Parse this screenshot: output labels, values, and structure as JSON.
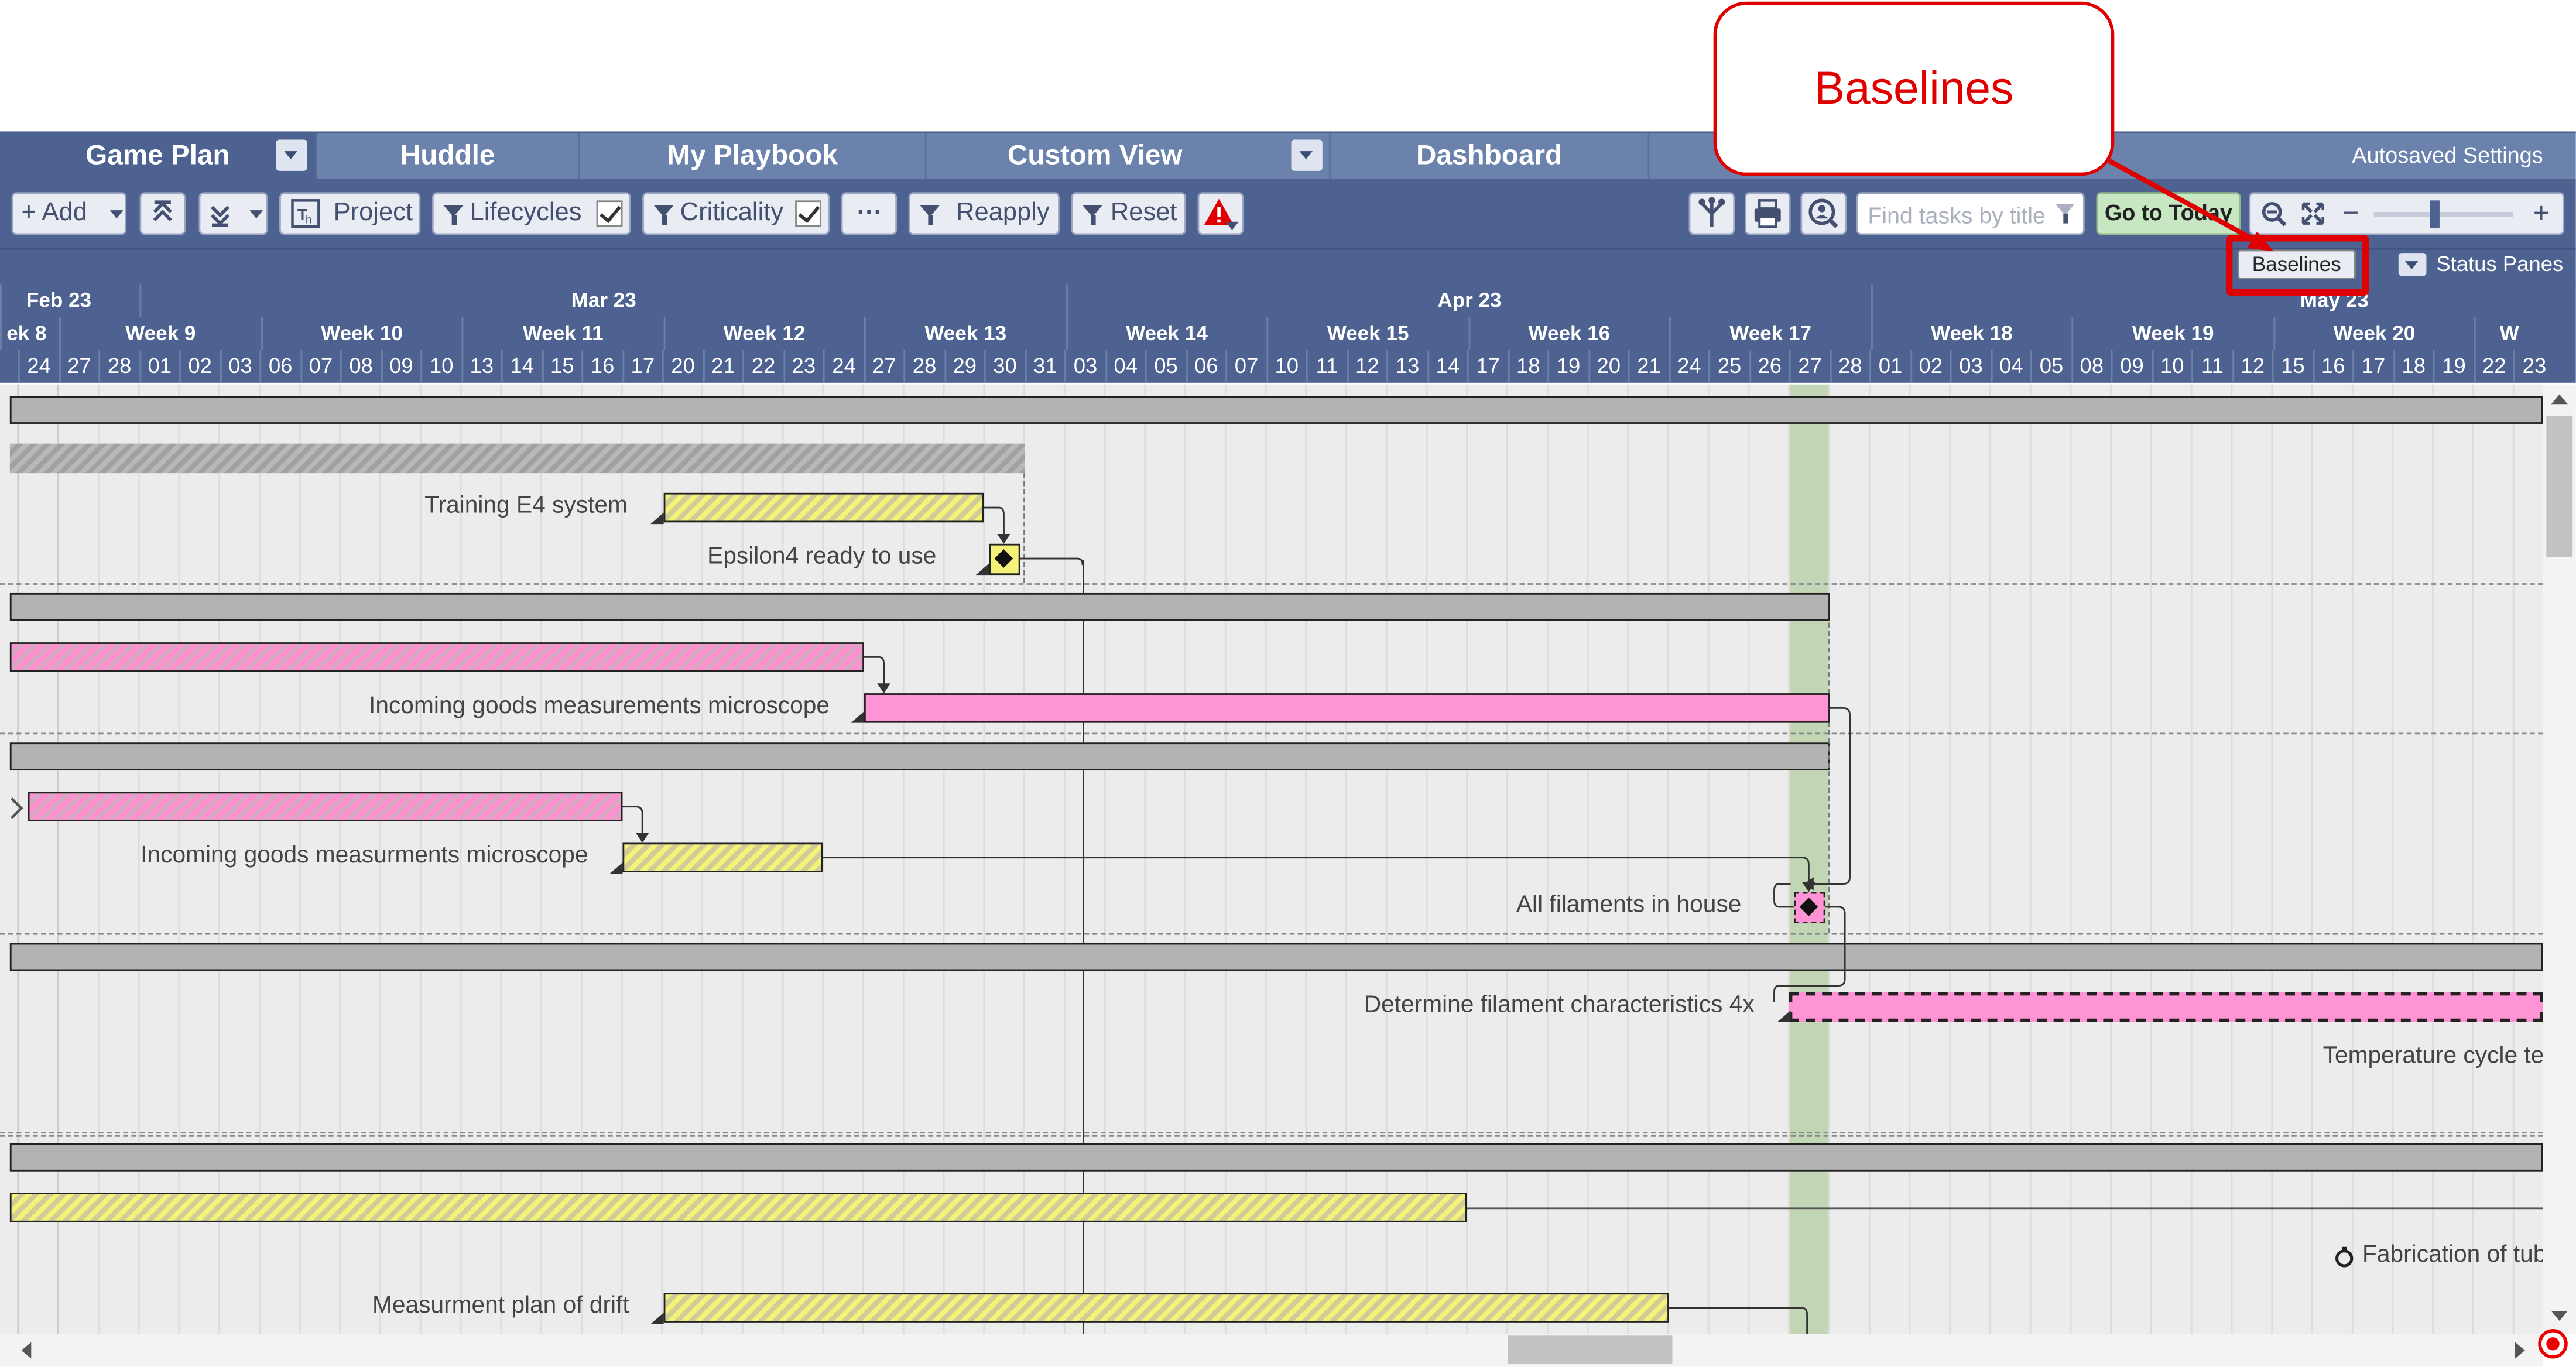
{
  "nav": {
    "tabs": [
      {
        "label": "Game Plan"
      },
      {
        "label": "Huddle"
      },
      {
        "label": "My Playbook"
      },
      {
        "label": "Custom View"
      },
      {
        "label": "Dashboard"
      }
    ],
    "autosaved": "Autosaved Settings"
  },
  "toolbar": {
    "add": "+ Add",
    "project": "Project",
    "lifecycles": "Lifecycles",
    "criticality": "Criticality",
    "more": "⋯",
    "reapply": "Reapply",
    "reset": "Reset",
    "search_placeholder": "Find tasks by title",
    "goto_today": "Go to Today",
    "zoom_level": 0.43
  },
  "subbar": {
    "baselines": "Baselines",
    "status_panes": "Status Panes"
  },
  "callout": {
    "text": "Baselines"
  },
  "timeline": {
    "months": [
      "Feb 23",
      "Mar 23",
      "Apr 23",
      "May 23"
    ],
    "weeks": [
      "ek 8",
      "Week 9",
      "Week 10",
      "Week 11",
      "Week 12",
      "Week 13",
      "Week 14",
      "Week 15",
      "Week 16",
      "Week 17",
      "Week 18",
      "Week 19",
      "Week 20",
      "W"
    ],
    "days": [
      "24",
      "27",
      "28",
      "01",
      "02",
      "03",
      "06",
      "07",
      "08",
      "09",
      "10",
      "13",
      "14",
      "15",
      "16",
      "17",
      "20",
      "21",
      "22",
      "23",
      "24",
      "27",
      "28",
      "29",
      "30",
      "31",
      "03",
      "04",
      "05",
      "06",
      "07",
      "10",
      "11",
      "12",
      "13",
      "14",
      "17",
      "18",
      "19",
      "20",
      "21",
      "24",
      "25",
      "26",
      "27",
      "28",
      "01",
      "02",
      "03",
      "04",
      "05",
      "08",
      "09",
      "10",
      "11",
      "12",
      "15",
      "16",
      "17",
      "18",
      "19",
      "22",
      "23"
    ]
  },
  "tasks": {
    "training_e4": "Training E4 system",
    "epsilon4": "Epsilon4 ready to use",
    "incoming_1": "Incoming goods measurements microscope",
    "incoming_2": "Incoming goods measurments microscope",
    "filaments": "All filaments in house",
    "determine": "Determine filament characteristics 4x",
    "temperature": "Temperature cycle tes",
    "fabrication": "Fabrication of tube",
    "measurement": "Measurment plan of drift"
  },
  "colors": {
    "nav": "#6b82ad",
    "toolbar": "#4d6290",
    "today": "#c2d5b5",
    "yellow": "#f5f27a",
    "pink": "#ff94d4",
    "callout": "#e00000"
  }
}
